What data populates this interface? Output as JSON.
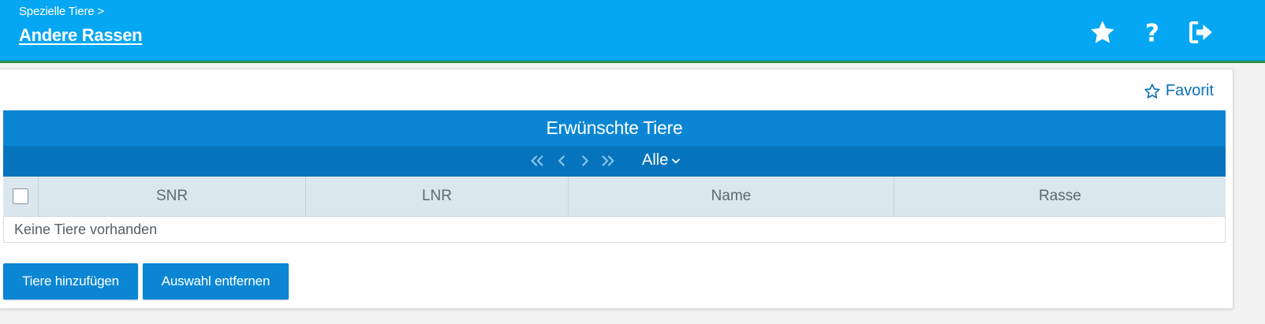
{
  "header": {
    "breadcrumb": "Spezielle Tiere >",
    "title": "Andere Rassen",
    "icons": [
      "star-icon",
      "help-icon",
      "logout-icon"
    ]
  },
  "panel": {
    "favorit_label": "Favorit"
  },
  "grid": {
    "title": "Erwünschte Tiere",
    "pager": {
      "icons": [
        "double-chevron-left-icon",
        "chevron-left-icon",
        "chevron-right-icon",
        "double-chevron-right-icon"
      ],
      "selected": "Alle"
    },
    "columns": [
      "SNR",
      "LNR",
      "Name",
      "Rasse"
    ],
    "empty_message": "Keine Tiere vorhanden"
  },
  "actions": {
    "add_label": "Tiere hinzufügen",
    "remove_label": "Auswahl entfernen"
  },
  "colors": {
    "header_bg": "#06a7f2",
    "header_border": "#2b8c3a",
    "grid_title_bg": "#0b86d4",
    "pager_bg": "#0674bd",
    "table_head_bg": "#dbe7ef",
    "accent": "#0a72b9"
  }
}
